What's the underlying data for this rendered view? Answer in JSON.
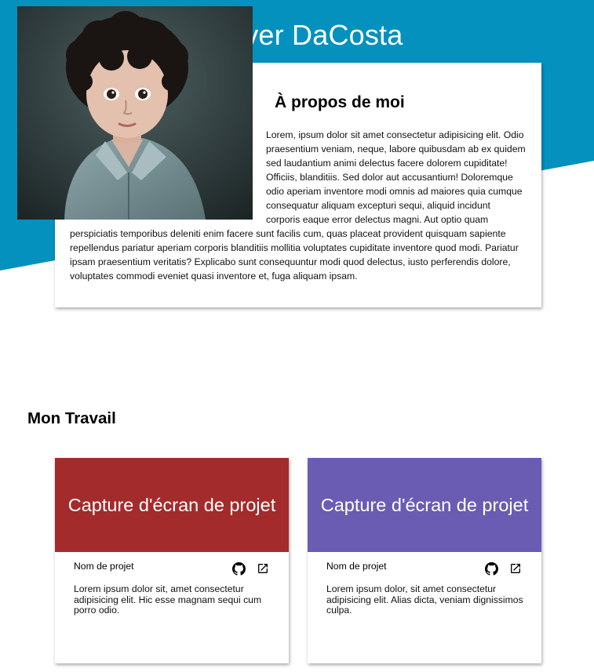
{
  "colors": {
    "hero_blue": "#0591bd",
    "project_1_bg": "#a42b2c",
    "project_2_bg": "#6a5cb2"
  },
  "header": {
    "title": "Ever DaCosta"
  },
  "about": {
    "title": "À propos de moi",
    "text": "Lorem, ipsum dolor sit amet consectetur adipisicing elit. Odio praesentium veniam, neque, labore quibusdam ab ex quidem sed laudantium animi delectus facere dolorem cupiditate! Officiis, blanditiis. Sed dolor aut accusantium! Doloremque odio aperiam inventore modi omnis ad maiores quia cumque consequatur aliquam excepturi sequi, aliquid incidunt corporis eaque error delectus magni. Aut optio quam perspiciatis temporibus deleniti enim facere sunt facilis cum, quas placeat provident quisquam sapiente repellendus pariatur aperiam corporis blanditiis mollitia voluptates cupiditate inventore quod modi. Pariatur ipsam praesentium veritatis? Explicabo sunt consequuntur modi quod delectus, iusto perferendis dolore, voluptates commodi eveniet quasi inventore et, fuga aliquam ipsam."
  },
  "work": {
    "title": "Mon Travail",
    "projects": [
      {
        "screenshot_label": "Capture d'écran de projet",
        "name": "Nom de projet",
        "github_icon": "github-icon",
        "link_icon": "external-link-icon",
        "description": "Lorem ipsum dolor sit, amet consectetur adipisicing elit. Hic esse magnam sequi cum porro odio."
      },
      {
        "screenshot_label": "Capture d'écran de projet",
        "name": "Nom de projet",
        "github_icon": "github-icon",
        "link_icon": "external-link-icon",
        "description": "Lorem ipsum dolor, sit amet consectetur adipisicing elit. Alias dicta, veniam dignissimos culpa."
      }
    ]
  }
}
